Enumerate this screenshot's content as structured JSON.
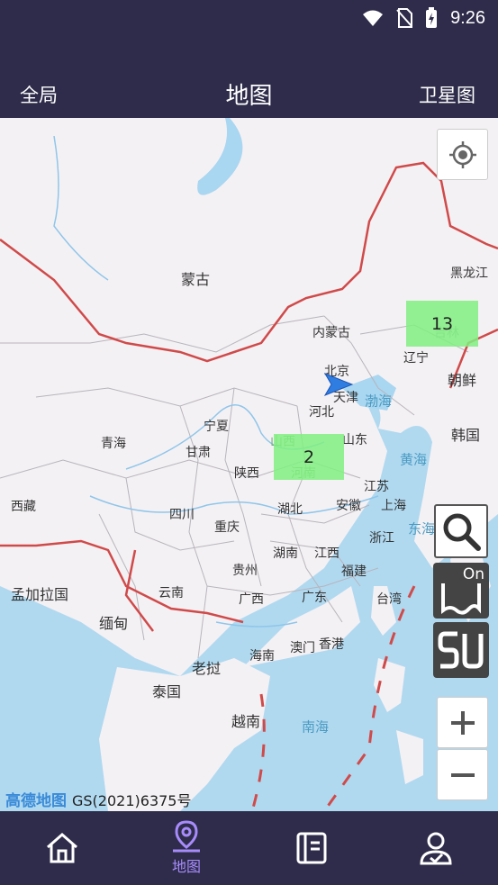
{
  "status": {
    "time": "9:26"
  },
  "header": {
    "left": "全局",
    "title": "地图",
    "right": "卫星图"
  },
  "map": {
    "countries": [
      {
        "name": "蒙古"
      },
      {
        "name": "朝鲜"
      },
      {
        "name": "韩国"
      },
      {
        "name": "孟加拉国"
      },
      {
        "name": "缅甸"
      },
      {
        "name": "老挝"
      },
      {
        "name": "泰国"
      },
      {
        "name": "越南"
      }
    ],
    "provinces": [
      "黑龙江",
      "吉林",
      "辽宁",
      "内蒙古",
      "北京",
      "天津",
      "河北",
      "山西",
      "山东",
      "宁夏",
      "甘肃",
      "青海",
      "陕西",
      "河南",
      "西藏",
      "四川",
      "湖北",
      "安徽",
      "江苏",
      "上海",
      "重庆",
      "浙江",
      "湖南",
      "江西",
      "贵州",
      "福建",
      "云南",
      "广西",
      "广东",
      "台湾",
      "海南",
      "澳门",
      "香港"
    ],
    "seas": [
      "渤海",
      "黄海",
      "东海",
      "南海"
    ],
    "clusters": [
      {
        "count": "13"
      },
      {
        "count": "2"
      }
    ],
    "toggle_label": "On",
    "brand": "高德地图",
    "license": "GS(2021)6375号"
  },
  "tabs": [
    {
      "name": "home",
      "label": ""
    },
    {
      "name": "map",
      "label": "地图"
    },
    {
      "name": "list",
      "label": ""
    },
    {
      "name": "profile",
      "label": ""
    }
  ],
  "colors": {
    "bar": "#2e2c4a",
    "accent": "#a78bfa",
    "cluster": "#80f080",
    "border": "#d04a4a",
    "water": "#a9d6f0"
  }
}
